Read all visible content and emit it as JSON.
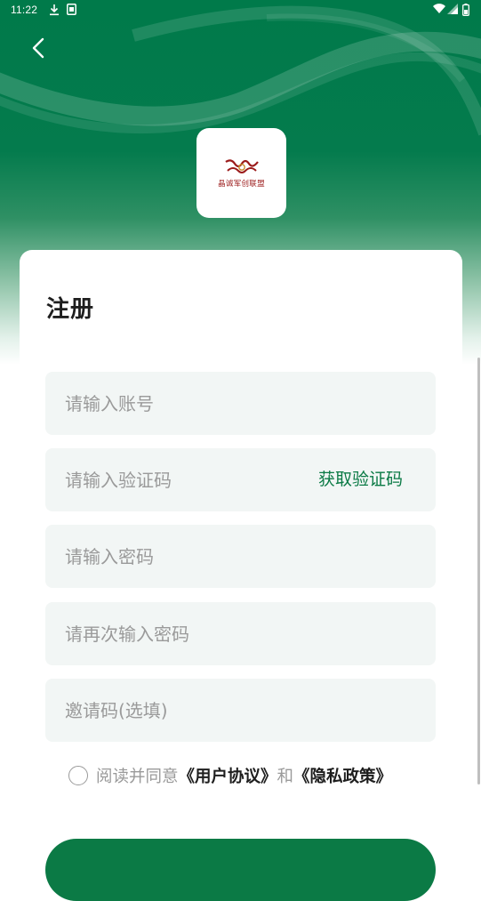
{
  "status_bar": {
    "time": "11:22"
  },
  "logo": {
    "caption": "晶诚军创联盟",
    "brand_color": "#9b1b1b"
  },
  "page": {
    "title": "注册"
  },
  "form": {
    "account_placeholder": "请输入账号",
    "code_placeholder": "请输入验证码",
    "get_code_label": "获取验证码",
    "password_placeholder": "请输入密码",
    "password_confirm_placeholder": "请再次输入密码",
    "invite_placeholder": "邀请码(选填)"
  },
  "agreement": {
    "prefix": "阅读并同意",
    "user_agreement": "《用户协议》",
    "conjunction": "和",
    "privacy_policy": "《隐私政策》",
    "checked": false
  },
  "colors": {
    "primary": "#0b7a45",
    "field_bg": "#f2f6f5",
    "placeholder": "#9a9a9a"
  },
  "icons": {
    "back": "chevron-left-icon",
    "download": "download-icon",
    "sim": "sim-card-icon",
    "wifi": "wifi-icon",
    "signal": "signal-icon",
    "battery": "battery-icon"
  }
}
